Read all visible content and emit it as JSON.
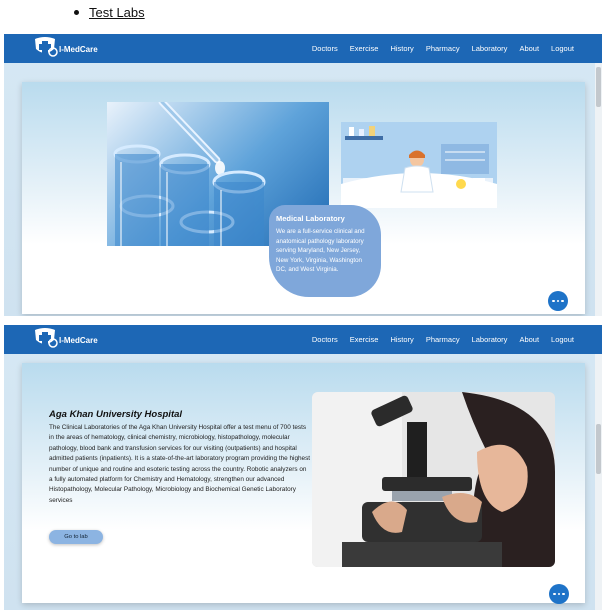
{
  "doc": {
    "bullet_link": "Test Labs"
  },
  "nav": {
    "brand": "I-MedCare",
    "items": [
      "Doctors",
      "Exercise",
      "History",
      "Pharmacy",
      "Laboratory",
      "About",
      "Logout"
    ]
  },
  "lab_card": {
    "title": "Medical Laboratory",
    "text": "We are a full-service clinical and anatomical pathology laboratory serving Maryland, New Jersey, New York, Virginia, Washington DC, and West Virginia."
  },
  "hospital": {
    "name": "Aga Khan University Hospital",
    "description": "The Clinical Laboratories of the Aga Khan University Hospital offer a test menu of 700 tests in the areas of hematology, clinical chemistry, microbiology, histopathology, molecular pathology, blood bank and transfusion services for our visiting (outpatients) and hospital admitted patients (inpatients). It is a state-of-the-art laboratory program providing the highest number of unique and routine and esoteric testing across the country. Robotic analyzers on a fully automated platform for Chemistry and Hematology, strengthen our advanced Histopathology, Molecular Pathology, Microbiology and Biochemical Genetic Laboratory services",
    "button": "Go to lab"
  },
  "icons": {
    "chat": "chat-bubble-icon",
    "logo": "medical-cross-logo-icon"
  },
  "colors": {
    "navbar": "#1d67b5",
    "page_bg": "#d6e8f4",
    "button": "#8cb4e2",
    "chat": "#1e73c8"
  }
}
